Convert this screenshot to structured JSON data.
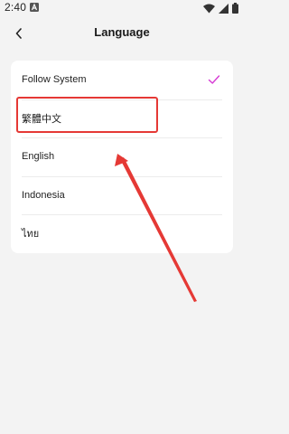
{
  "status_bar": {
    "time": "2:40",
    "notification_icon": "a-icon",
    "wifi_icon": "wifi-icon",
    "signal_icon": "signal-icon",
    "battery_icon": "battery-icon"
  },
  "header": {
    "back_icon": "chevron-left-icon",
    "title": "Language"
  },
  "languages": {
    "items": [
      {
        "label": "Follow System",
        "selected": true
      },
      {
        "label": "繁體中文",
        "selected": false
      },
      {
        "label": "English",
        "selected": false
      },
      {
        "label": "Indonesia",
        "selected": false
      },
      {
        "label": "ไทย",
        "selected": false
      }
    ]
  },
  "colors": {
    "accent_check": "#d63ad4",
    "annotation_red": "#e53935",
    "background": "#f3f3f3",
    "card": "#ffffff"
  }
}
